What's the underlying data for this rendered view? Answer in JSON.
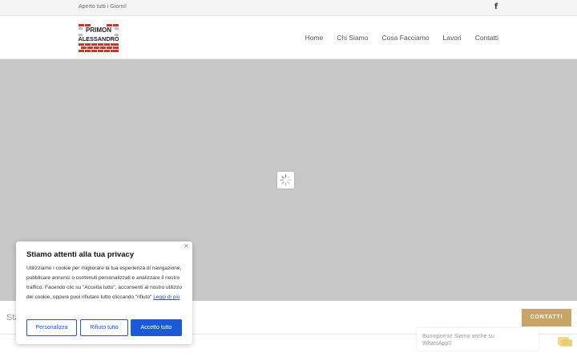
{
  "topbar": {
    "text": "Aperto tutti i Giorni!",
    "facebook_icon": "f"
  },
  "logo": {
    "line1": "PRIMON",
    "line2": "ALESSANDRO"
  },
  "nav": {
    "items": [
      "Home",
      "Chi Siamo",
      "Cosa Facciamo",
      "Lavori",
      "Contatti"
    ]
  },
  "contact_strip": {
    "text": "Sta",
    "button_label": "CONTATTI"
  },
  "whatsapp": {
    "text": "Buongiorno! Siamo anche su WhatsApp!!"
  },
  "cookie": {
    "close": "×",
    "title": "Stiamo attenti alla tua privacy",
    "body": "Utilizziamo i cookie per migliorare la tua esperienza di navigazione, pubblicare annunci o contenuti personalizzati e analizzare il nostro traffico. Facendo clic su \"Accetta tutto\", acconsenti al nostro utilizzo dei cookie, oppure puoi rifiutare tutto cliccando \"rifiuto\"",
    "link": "Leggi di più",
    "buttons": {
      "customize": "Personalizza",
      "reject": "Rifiuto tutto",
      "accept": "Accetto tutto"
    }
  },
  "colors": {
    "accent": "#c7a565",
    "cookie_blue": "#1a5ad8",
    "brick_red": "#c0392b",
    "hero_gray": "#c8c8c8"
  }
}
